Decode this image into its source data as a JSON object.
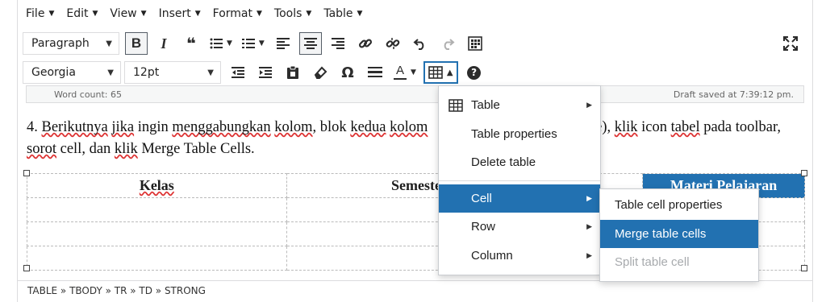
{
  "menubar": {
    "items": [
      {
        "label": "File"
      },
      {
        "label": "Edit"
      },
      {
        "label": "View"
      },
      {
        "label": "Insert"
      },
      {
        "label": "Format"
      },
      {
        "label": "Tools"
      },
      {
        "label": "Table"
      }
    ]
  },
  "toolbar": {
    "block_format": "Paragraph",
    "font_family": "Georgia",
    "font_size": "12pt",
    "text_color_glyph": "A",
    "omega_glyph": "Ω",
    "bold_glyph": "B",
    "italic_glyph": "I",
    "quote_glyph": "❝",
    "help_glyph": "?",
    "table_button_active": true
  },
  "status": {
    "word_count": "Word count: 65",
    "draft_saved": "Draft saved at 7:39:12 pm."
  },
  "content": {
    "paragraph_parts": [
      "4. ",
      "Berikutnya",
      " ",
      "jika",
      " ingin ",
      "menggabungkan",
      " ",
      "kolom",
      ", blok ",
      "kedua",
      " ",
      "kolom",
      "n (merge), ",
      "klik",
      " icon ",
      "tabel",
      " pada toolbar, ",
      "sorot",
      " cell, dan ",
      "klik",
      "  Merge Table Cells."
    ],
    "table_headers": [
      "Kelas",
      "Semeste",
      "",
      "Materi Pelajaran"
    ]
  },
  "path": "TABLE » TBODY » TR » TD » STRONG",
  "table_menu": {
    "items": [
      {
        "label": "Table"
      },
      {
        "label": "Table properties"
      },
      {
        "label": "Delete table"
      },
      {
        "label": "Cell"
      },
      {
        "label": "Row"
      },
      {
        "label": "Column"
      }
    ]
  },
  "cell_menu": {
    "items": [
      {
        "label": "Table cell properties"
      },
      {
        "label": "Merge table cells"
      },
      {
        "label": "Split table cell"
      }
    ]
  },
  "colors": {
    "accent": "#2271b1",
    "disabled": "#a7aaad",
    "spellcheck": "#dd3333"
  }
}
